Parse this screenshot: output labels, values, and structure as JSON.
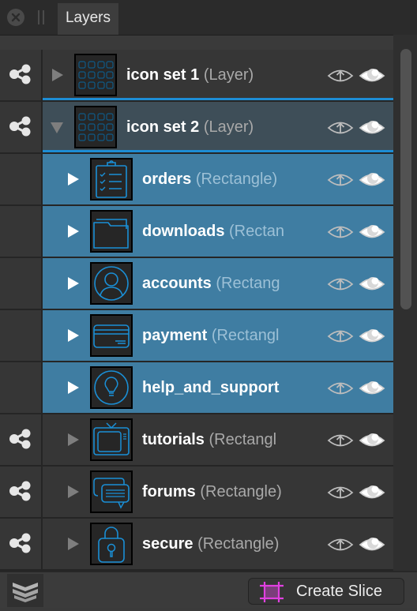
{
  "panel": {
    "tab_label": "Layers",
    "close_icon": "close-circle-icon",
    "grip_icon": "drag-grip-icon"
  },
  "layers": [
    {
      "name": "icon set 1",
      "type": "(Layer)",
      "state": "collapsed",
      "selected": false,
      "thumbnail": "icon-grid-thumbnail"
    },
    {
      "name": "icon set 2",
      "type": "(Layer)",
      "state": "expanded",
      "selected": "parent",
      "thumbnail": "icon-grid-thumbnail"
    },
    {
      "name": "orders",
      "type": "(Rectangle)",
      "state": "collapsed",
      "selected": true,
      "thumbnail": "clipboard-checklist-icon"
    },
    {
      "name": "downloads",
      "type": "(Rectan",
      "state": "collapsed",
      "selected": true,
      "thumbnail": "folder-icon"
    },
    {
      "name": "accounts",
      "type": "(Rectang",
      "state": "collapsed",
      "selected": true,
      "thumbnail": "user-circle-icon"
    },
    {
      "name": "payment",
      "type": "(Rectangl",
      "state": "collapsed",
      "selected": true,
      "thumbnail": "credit-card-icon"
    },
    {
      "name": "help_and_support",
      "type": "",
      "state": "collapsed",
      "selected": true,
      "thumbnail": "lightbulb-circle-icon"
    },
    {
      "name": "tutorials",
      "type": "(Rectangl",
      "state": "collapsed",
      "selected": false,
      "thumbnail": "tv-icon"
    },
    {
      "name": "forums",
      "type": "(Rectangle)",
      "state": "collapsed",
      "selected": false,
      "thumbnail": "chat-bubbles-icon"
    },
    {
      "name": "secure",
      "type": "(Rectangle)",
      "state": "collapsed",
      "selected": false,
      "thumbnail": "padlock-icon"
    }
  ],
  "row_icons": {
    "link": "share-nodes-icon",
    "export": "eye-export-icon",
    "visibility": "eye-icon"
  },
  "footer": {
    "layers_toggle_icon": "layers-stack-icon",
    "create_slice_label": "Create Slice",
    "slice_icon": "slice-crop-icon"
  },
  "colors": {
    "selection": "#3f7da2",
    "parent_selection": "#3e4e58",
    "accent": "#1d8dd4",
    "thumbnail_stroke": "#1a8fd6",
    "slice_icon": "#e040e0"
  }
}
